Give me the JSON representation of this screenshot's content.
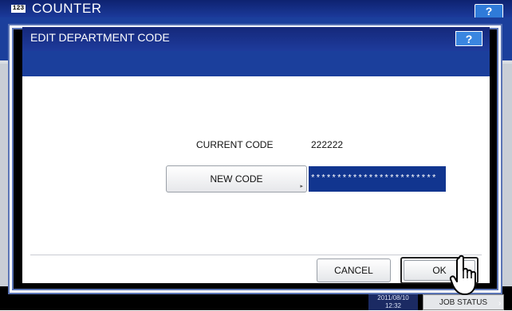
{
  "background": {
    "header_icon": "123",
    "header_title": "COUNTER",
    "help_label": "?"
  },
  "taskbar": {
    "clock_date": "2011/08/10",
    "clock_time": "12:32",
    "job_status_label": "JOB STATUS"
  },
  "dialog": {
    "title": "EDIT DEPARTMENT CODE",
    "help_label": "?",
    "current_code_label": "CURRENT CODE",
    "current_code_value": "222222",
    "new_code_label": "NEW CODE",
    "new_code_value": "************************",
    "cancel_label": "CANCEL",
    "ok_label": "OK"
  },
  "colors": {
    "header_blue": "#15287a",
    "band_blue": "#1b3f9c",
    "field_blue": "#11358f",
    "help_blue": "#3a86e0"
  },
  "icons": [
    "pointing-hand-icon",
    "counter-123-icon"
  ]
}
